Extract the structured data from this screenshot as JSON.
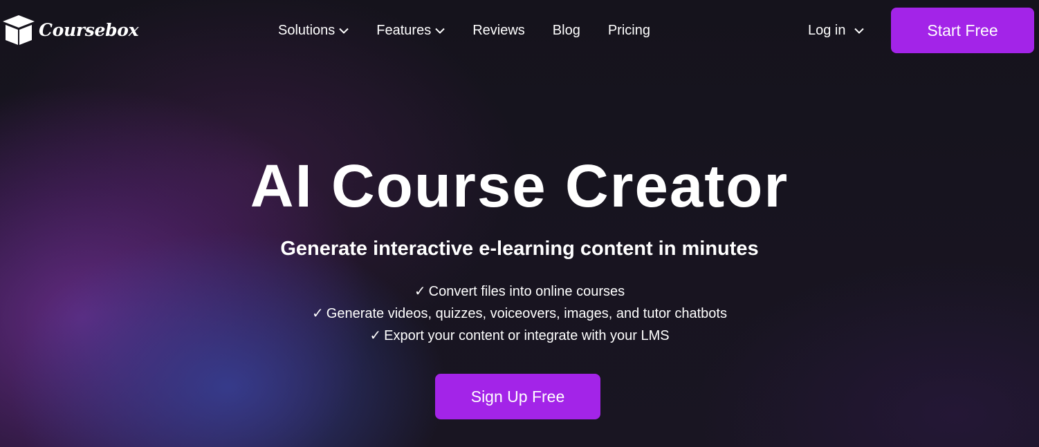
{
  "brand": {
    "name": "Coursebox",
    "logo_icon": "graduation-box-icon"
  },
  "nav": {
    "items": [
      {
        "label": "Solutions",
        "has_dropdown": true
      },
      {
        "label": "Features",
        "has_dropdown": true
      },
      {
        "label": "Reviews",
        "has_dropdown": false
      },
      {
        "label": "Blog",
        "has_dropdown": false
      },
      {
        "label": "Pricing",
        "has_dropdown": false
      }
    ],
    "login_label": "Log in",
    "start_free_label": "Start Free"
  },
  "hero": {
    "title": "AI Course Creator",
    "subtitle": "Generate interactive e-learning content in minutes",
    "check_glyph": "✓",
    "features": [
      "Convert files into online courses",
      "Generate videos, quizzes, voiceovers, images, and tutor chatbots",
      "Export your content or integrate with your LMS"
    ],
    "cta_label": "Sign Up Free"
  },
  "colors": {
    "accent": "#a324e8",
    "background": "#15131c",
    "text": "#ffffff"
  }
}
